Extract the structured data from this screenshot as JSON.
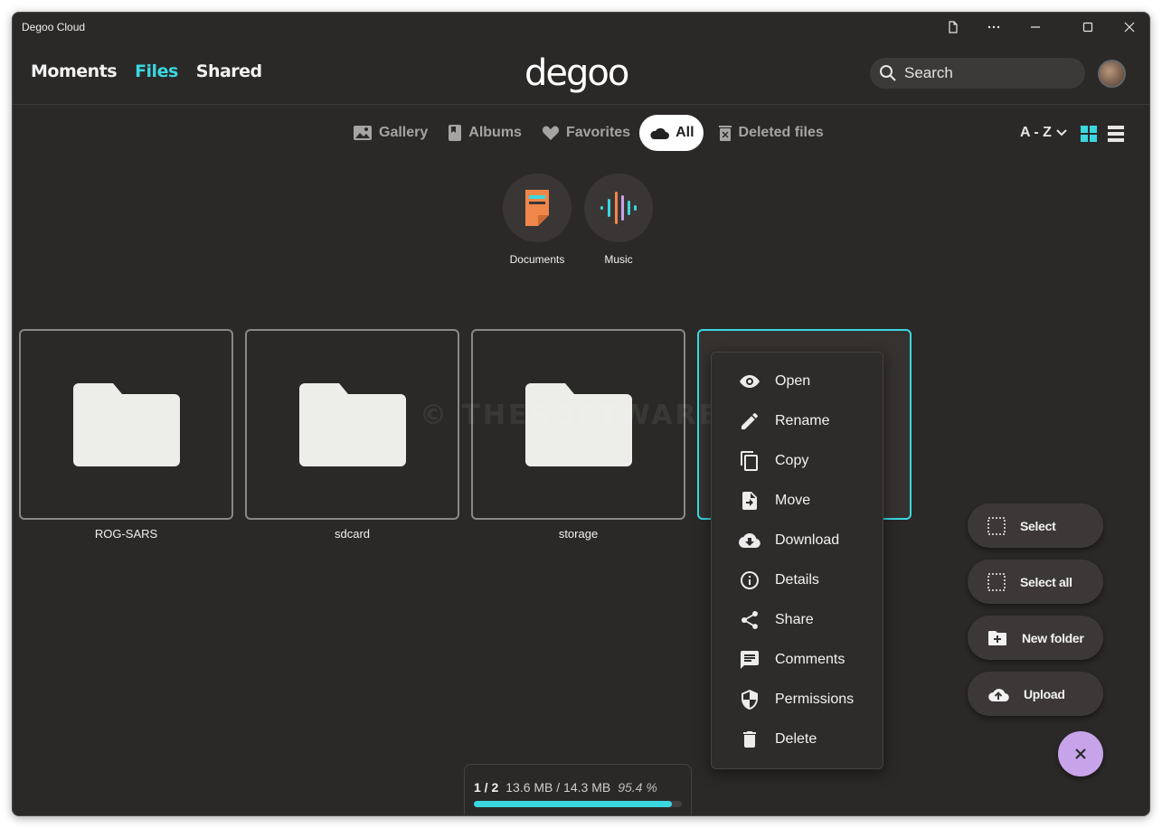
{
  "window": {
    "title": "Degoo Cloud"
  },
  "nav": {
    "moments": "Moments",
    "files": "Files",
    "shared": "Shared"
  },
  "logo": "degoo",
  "search": {
    "placeholder": "Search"
  },
  "filters": {
    "gallery": "Gallery",
    "albums": "Albums",
    "favorites": "Favorites",
    "all": "All",
    "deleted": "Deleted files"
  },
  "sort": {
    "label": "A - Z"
  },
  "categories": {
    "documents": "Documents",
    "music": "Music"
  },
  "folders": [
    "ROG-SARS",
    "sdcard",
    "storage"
  ],
  "watermark": "© THESOFTWARE.SHOP",
  "context_menu": {
    "open": "Open",
    "rename": "Rename",
    "copy": "Copy",
    "move": "Move",
    "download": "Download",
    "details": "Details",
    "share": "Share",
    "comments": "Comments",
    "permissions": "Permissions",
    "delete": "Delete"
  },
  "actions": {
    "select": "Select",
    "select_all": "Select all",
    "new_folder": "New folder",
    "upload": "Upload"
  },
  "upload_status": {
    "count": "1 / 2",
    "size": "13.6 MB / 14.3 MB",
    "percent_text": "95.4 %",
    "progress_fraction": 0.954
  },
  "colors": {
    "accent": "#3ad7e0",
    "fab_close": "#c7a4ea",
    "background": "#2b2928"
  }
}
